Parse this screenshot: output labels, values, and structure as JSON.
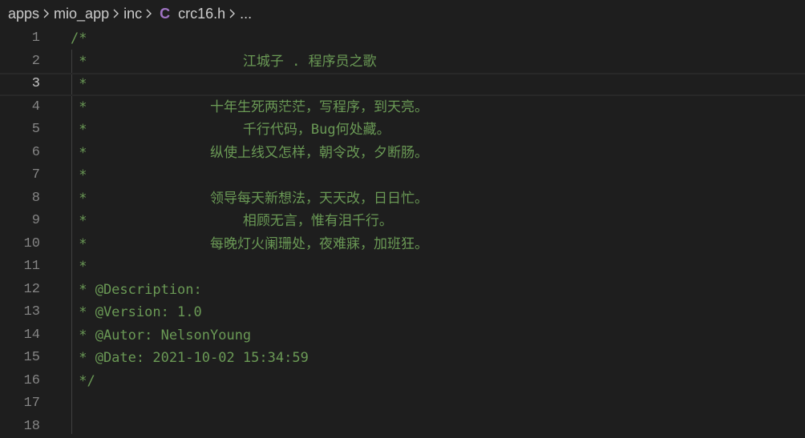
{
  "breadcrumb": {
    "items": [
      "apps",
      "mio_app",
      "inc",
      "crc16.h",
      "..."
    ],
    "file_icon": "c-language-icon",
    "file_icon_glyph": "C"
  },
  "editor": {
    "current_line": 3,
    "lines": [
      {
        "n": "1",
        "text": "/*"
      },
      {
        "n": "2",
        "text": " *                   江城子 . 程序员之歌"
      },
      {
        "n": "3",
        "text": " *"
      },
      {
        "n": "4",
        "text": " *               十年生死两茫茫，写程序，到天亮。"
      },
      {
        "n": "5",
        "text": " *                   千行代码，Bug何处藏。"
      },
      {
        "n": "6",
        "text": " *               纵使上线又怎样，朝令改，夕断肠。"
      },
      {
        "n": "7",
        "text": " *"
      },
      {
        "n": "8",
        "text": " *               领导每天新想法，天天改，日日忙。"
      },
      {
        "n": "9",
        "text": " *                   相顾无言，惟有泪千行。"
      },
      {
        "n": "10",
        "text": " *               每晚灯火阑珊处，夜难寐，加班狂。"
      },
      {
        "n": "11",
        "text": " *"
      },
      {
        "n": "12",
        "text": " * @Description:"
      },
      {
        "n": "13",
        "text": " * @Version: 1.0"
      },
      {
        "n": "14",
        "text": " * @Autor: NelsonYoung"
      },
      {
        "n": "15",
        "text": " * @Date: 2021-10-02 15:34:59"
      },
      {
        "n": "16",
        "text": " */"
      },
      {
        "n": "17",
        "text": ""
      },
      {
        "n": "18",
        "text": ""
      }
    ]
  },
  "colors": {
    "background": "#1e1e1e",
    "comment": "#6a9955",
    "line_number": "#858585",
    "active_line_number": "#c6c6c6",
    "c_icon": "#a074c4"
  }
}
